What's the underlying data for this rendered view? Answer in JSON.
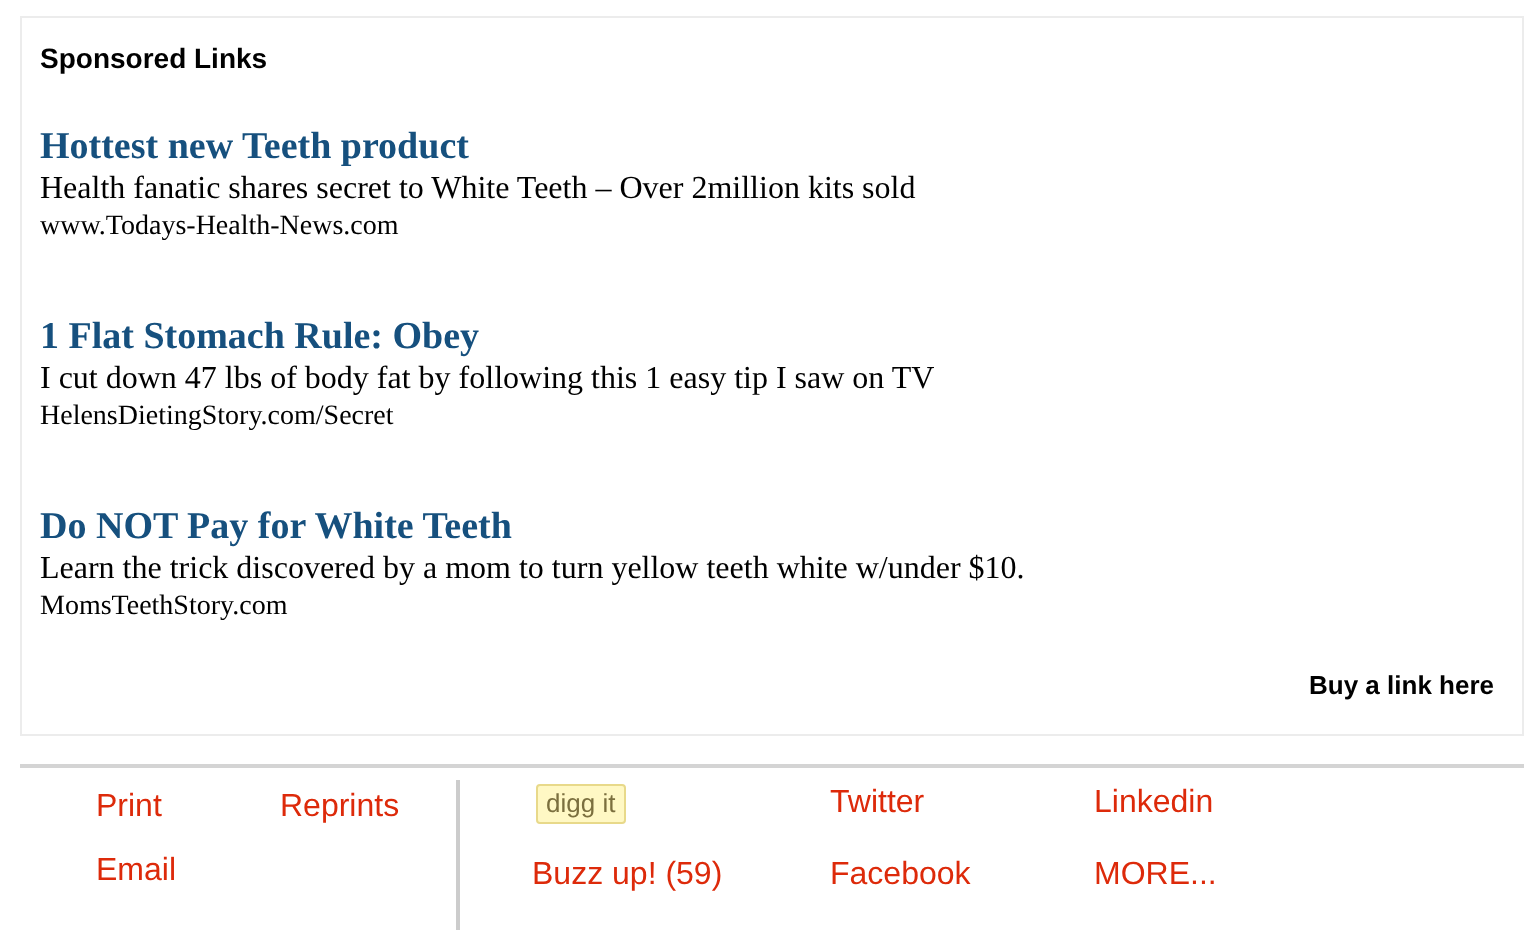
{
  "sponsored": {
    "heading": "Sponsored Links",
    "ads": [
      {
        "title": "Hottest new Teeth product",
        "description": "Health fanatic shares secret to White Teeth – Over 2million kits sold",
        "url": "www.Todays-Health-News.com"
      },
      {
        "title": "1 Flat Stomach Rule: Obey",
        "description": "I cut down 47 lbs of body fat by following this 1 easy tip I saw on TV",
        "url": "HelensDietingStory.com/Secret"
      },
      {
        "title": "Do NOT Pay for White Teeth",
        "description": "Learn the trick discovered by a mom to turn yellow teeth white w/under $10.",
        "url": "MomsTeethStory.com"
      }
    ],
    "buy_link": "Buy a link here"
  },
  "tools": {
    "left": [
      "Print",
      "Reprints",
      "Email"
    ],
    "share": [
      {
        "kind": "badge",
        "label": "digg it"
      },
      {
        "kind": "link",
        "label": "Twitter"
      },
      {
        "kind": "link",
        "label": "Linkedin"
      },
      {
        "kind": "link",
        "label": "Buzz up! (59)"
      },
      {
        "kind": "link",
        "label": "Facebook"
      },
      {
        "kind": "link",
        "label": "MORE..."
      }
    ]
  }
}
